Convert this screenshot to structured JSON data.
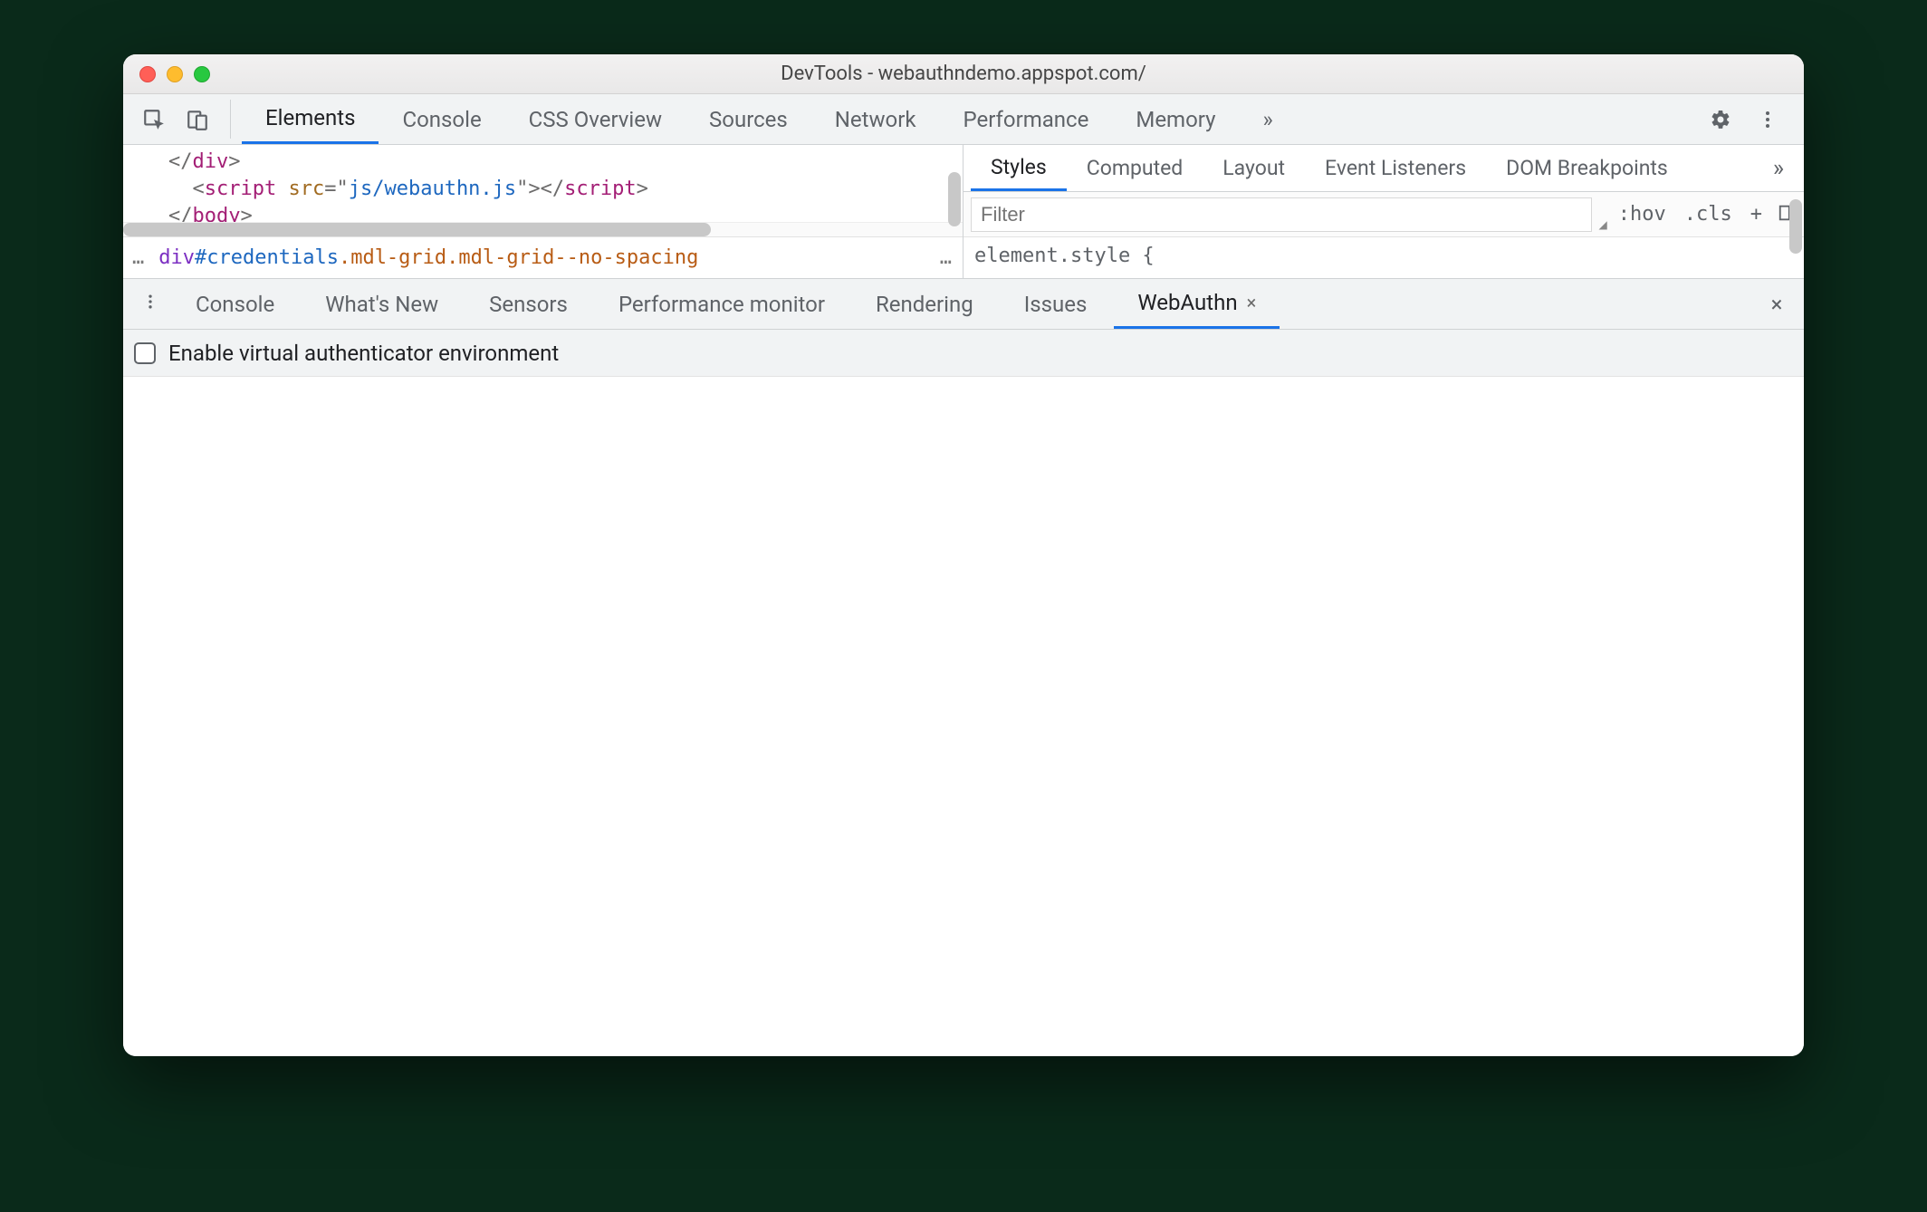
{
  "window": {
    "title": "DevTools - webauthndemo.appspot.com/"
  },
  "main_tabs": {
    "items": [
      "Elements",
      "Console",
      "CSS Overview",
      "Sources",
      "Network",
      "Performance",
      "Memory"
    ],
    "active": "Elements",
    "overflow_glyph": "»"
  },
  "dom_code": {
    "line1": {
      "open": "</",
      "tag": "div",
      "close": ">"
    },
    "line2": {
      "open": "<",
      "tag": "script",
      "sp": " ",
      "attr": "src",
      "eq": "=\"",
      "val": "js/webauthn.js",
      "q2": "\">",
      "etag_open": "</",
      "etag": "script",
      "etag_close": ">"
    },
    "line3": {
      "open": "</",
      "tag": "body",
      "close": ">"
    }
  },
  "breadcrumb": {
    "more": "…",
    "tag": "div",
    "id": "#credentials",
    "cls1": ".mdl-grid",
    "cls2": ".mdl-grid--no-spacing",
    "trail_more": "…"
  },
  "styles_tabs": {
    "items": [
      "Styles",
      "Computed",
      "Layout",
      "Event Listeners",
      "DOM Breakpoints"
    ],
    "active": "Styles",
    "overflow_glyph": "»"
  },
  "styles_filter": {
    "placeholder": "Filter",
    "hov": ":hov",
    "cls": ".cls",
    "plus": "+"
  },
  "styles_body": {
    "element_style": "element.style {"
  },
  "drawer_tabs": {
    "items": [
      "Console",
      "What's New",
      "Sensors",
      "Performance monitor",
      "Rendering",
      "Issues",
      "WebAuthn"
    ],
    "active": "WebAuthn",
    "close_glyph": "×"
  },
  "webauthn_panel": {
    "checkbox_label": "Enable virtual authenticator environment"
  }
}
